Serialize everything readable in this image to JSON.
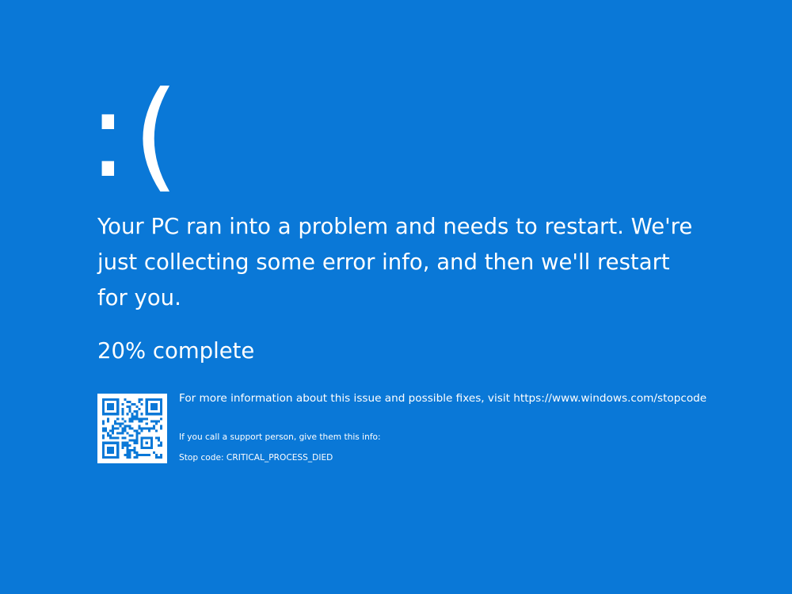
{
  "screen": {
    "background_color": "#0a78d7",
    "text_color": "#ffffff",
    "sad_face": ":(",
    "message": "Your PC ran into a problem and needs to restart. We're just collecting some error info, and then we'll restart for you.",
    "progress": {
      "percent": 20,
      "percent_label": "20%",
      "suffix": "complete"
    },
    "qr_code": {
      "icon": "qr-code-icon"
    },
    "more_info": "For more information about this issue and possible fixes, visit https://www.windows.com/stopcode",
    "support_info": "If you call a support person, give them this info:",
    "stop_code": "Stop code: CRITICAL_PROCESS_DIED"
  }
}
